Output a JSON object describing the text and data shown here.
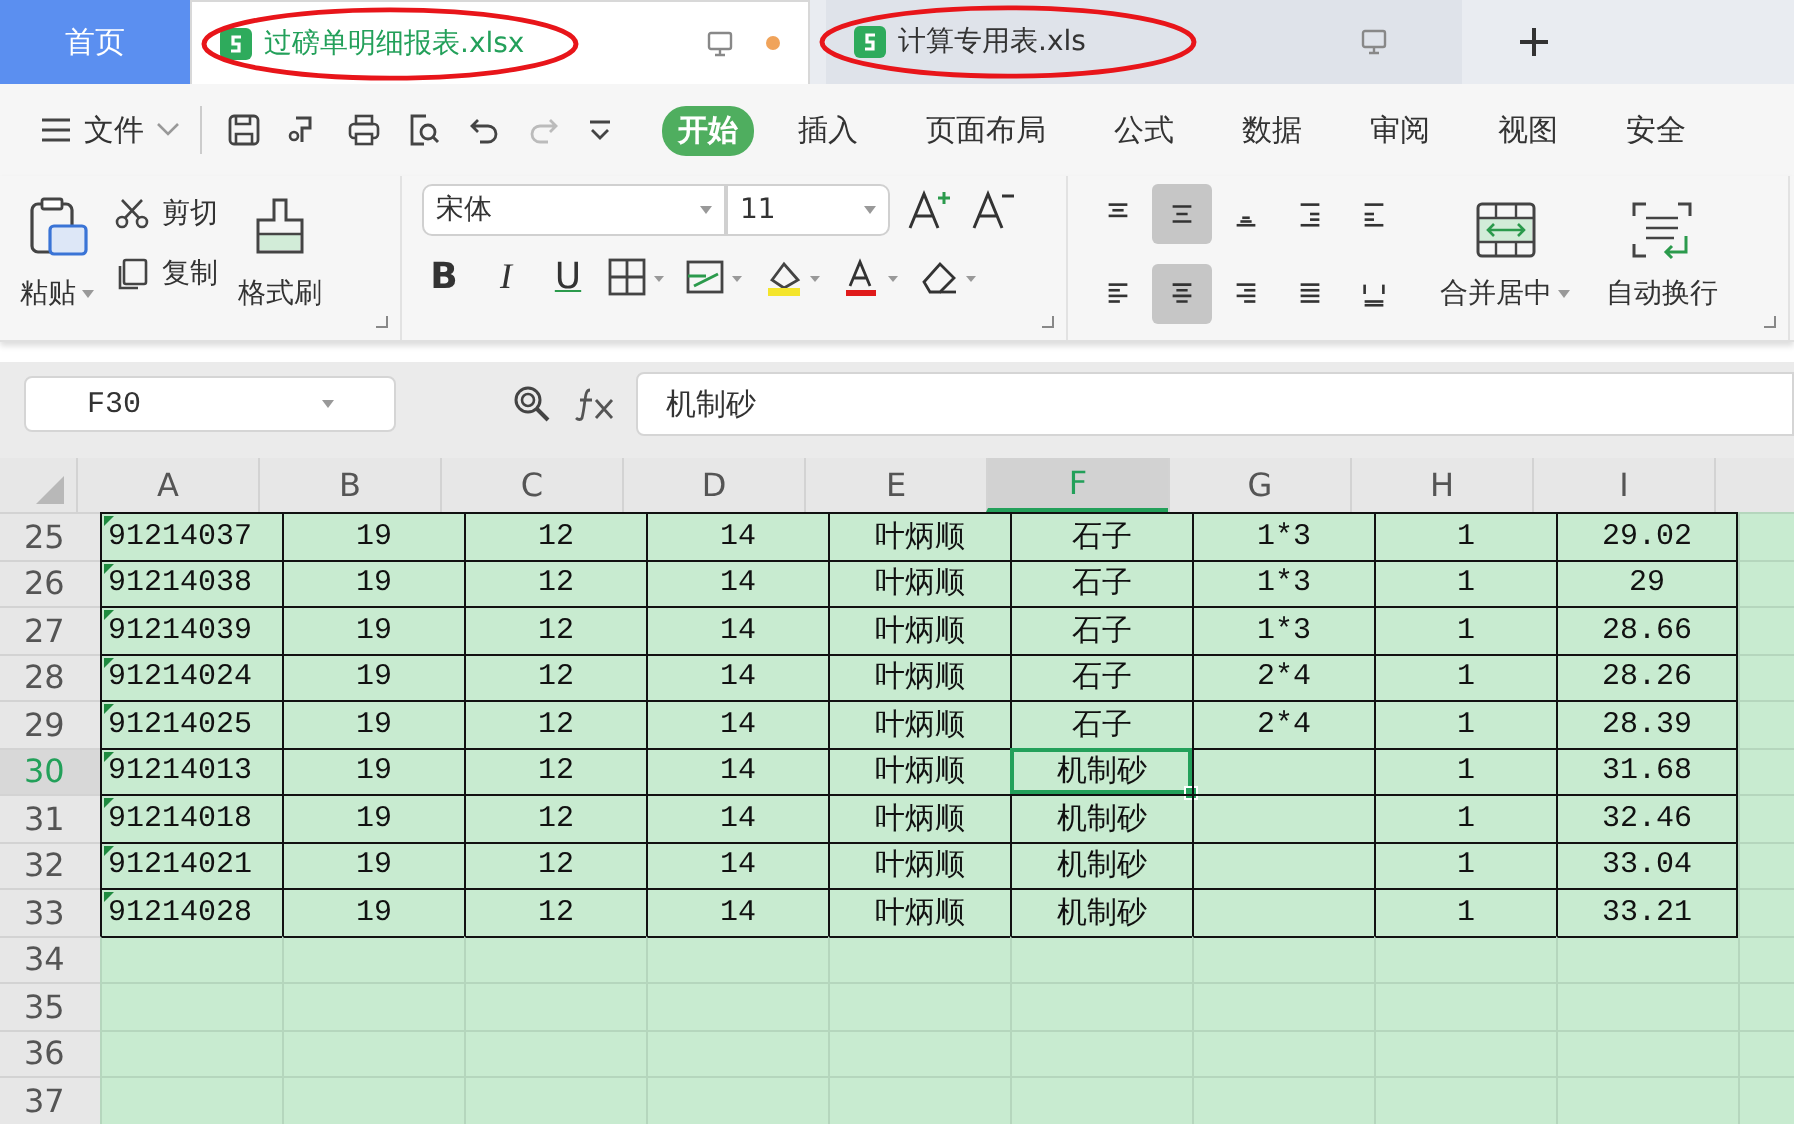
{
  "tabs": [
    {
      "kind": "home",
      "label": "首页",
      "selected": false
    },
    {
      "kind": "file",
      "label": "过磅单明细报表.xlsx",
      "selected": true,
      "circled": true,
      "modified": true
    },
    {
      "kind": "file",
      "label": "计算专用表.xls",
      "selected": false,
      "circled": true,
      "modified": false
    }
  ],
  "menu": {
    "file_label": "文件",
    "items": [
      {
        "label": "开始",
        "selected": true
      },
      {
        "label": "插入",
        "selected": false
      },
      {
        "label": "页面布局",
        "selected": false
      },
      {
        "label": "公式",
        "selected": false
      },
      {
        "label": "数据",
        "selected": false
      },
      {
        "label": "审阅",
        "selected": false
      },
      {
        "label": "视图",
        "selected": false
      },
      {
        "label": "安全",
        "selected": false
      }
    ]
  },
  "ribbon": {
    "paste": "粘贴",
    "cut": "剪切",
    "copy": "复制",
    "painter": "格式刷",
    "font_name": "宋体",
    "font_size": "11",
    "bold": "B",
    "italic": "I",
    "underline": "U",
    "alignment": [
      {
        "kind": "top",
        "selected": false
      },
      {
        "kind": "middle",
        "selected": true
      },
      {
        "kind": "bottom",
        "selected": false
      },
      {
        "kind": "outdent",
        "selected": false
      },
      {
        "kind": "indent",
        "selected": false
      },
      {
        "kind": "left",
        "selected": false
      },
      {
        "kind": "center",
        "selected": true
      },
      {
        "kind": "right",
        "selected": false
      },
      {
        "kind": "justify",
        "selected": false
      },
      {
        "kind": "distribute",
        "selected": false
      }
    ],
    "merge": "合并居中",
    "wrap": "自动换行"
  },
  "formula_bar": {
    "name_box": "F30",
    "formula": "机制砂"
  },
  "sheet": {
    "columns": [
      {
        "label": "A",
        "selected": false
      },
      {
        "label": "B",
        "selected": false
      },
      {
        "label": "C",
        "selected": false
      },
      {
        "label": "D",
        "selected": false
      },
      {
        "label": "E",
        "selected": false
      },
      {
        "label": "F",
        "selected": true
      },
      {
        "label": "G",
        "selected": false
      },
      {
        "label": "H",
        "selected": false
      },
      {
        "label": "I",
        "selected": false
      }
    ],
    "rows": [
      {
        "number": "25",
        "selected": false,
        "flagged": true,
        "cells": [
          "91214037",
          "19",
          "12",
          "14",
          "叶炳顺",
          "石子",
          "1*3",
          "1",
          "29.02"
        ]
      },
      {
        "number": "26",
        "selected": false,
        "flagged": true,
        "cells": [
          "91214038",
          "19",
          "12",
          "14",
          "叶炳顺",
          "石子",
          "1*3",
          "1",
          "29"
        ]
      },
      {
        "number": "27",
        "selected": false,
        "flagged": true,
        "cells": [
          "91214039",
          "19",
          "12",
          "14",
          "叶炳顺",
          "石子",
          "1*3",
          "1",
          "28.66"
        ]
      },
      {
        "number": "28",
        "selected": false,
        "flagged": true,
        "cells": [
          "91214024",
          "19",
          "12",
          "14",
          "叶炳顺",
          "石子",
          "2*4",
          "1",
          "28.26"
        ]
      },
      {
        "number": "29",
        "selected": false,
        "flagged": true,
        "cells": [
          "91214025",
          "19",
          "12",
          "14",
          "叶炳顺",
          "石子",
          "2*4",
          "1",
          "28.39"
        ]
      },
      {
        "number": "30",
        "selected": true,
        "flagged": true,
        "cells": [
          "91214013",
          "19",
          "12",
          "14",
          "叶炳顺",
          "机制砂",
          null,
          "1",
          "31.68"
        ]
      },
      {
        "number": "31",
        "selected": false,
        "flagged": true,
        "cells": [
          "91214018",
          "19",
          "12",
          "14",
          "叶炳顺",
          "机制砂",
          null,
          "1",
          "32.46"
        ]
      },
      {
        "number": "32",
        "selected": false,
        "flagged": true,
        "cells": [
          "91214021",
          "19",
          "12",
          "14",
          "叶炳顺",
          "机制砂",
          null,
          "1",
          "33.04"
        ]
      },
      {
        "number": "33",
        "selected": false,
        "flagged": true,
        "cells": [
          "91214028",
          "19",
          "12",
          "14",
          "叶炳顺",
          "机制砂",
          null,
          "1",
          "33.21"
        ]
      },
      {
        "number": "34",
        "selected": false,
        "flagged": false,
        "cells": []
      },
      {
        "number": "35",
        "selected": false,
        "flagged": false,
        "cells": []
      },
      {
        "number": "36",
        "selected": false,
        "flagged": false,
        "cells": []
      },
      {
        "number": "37",
        "selected": false,
        "flagged": false,
        "cells": []
      }
    ]
  }
}
